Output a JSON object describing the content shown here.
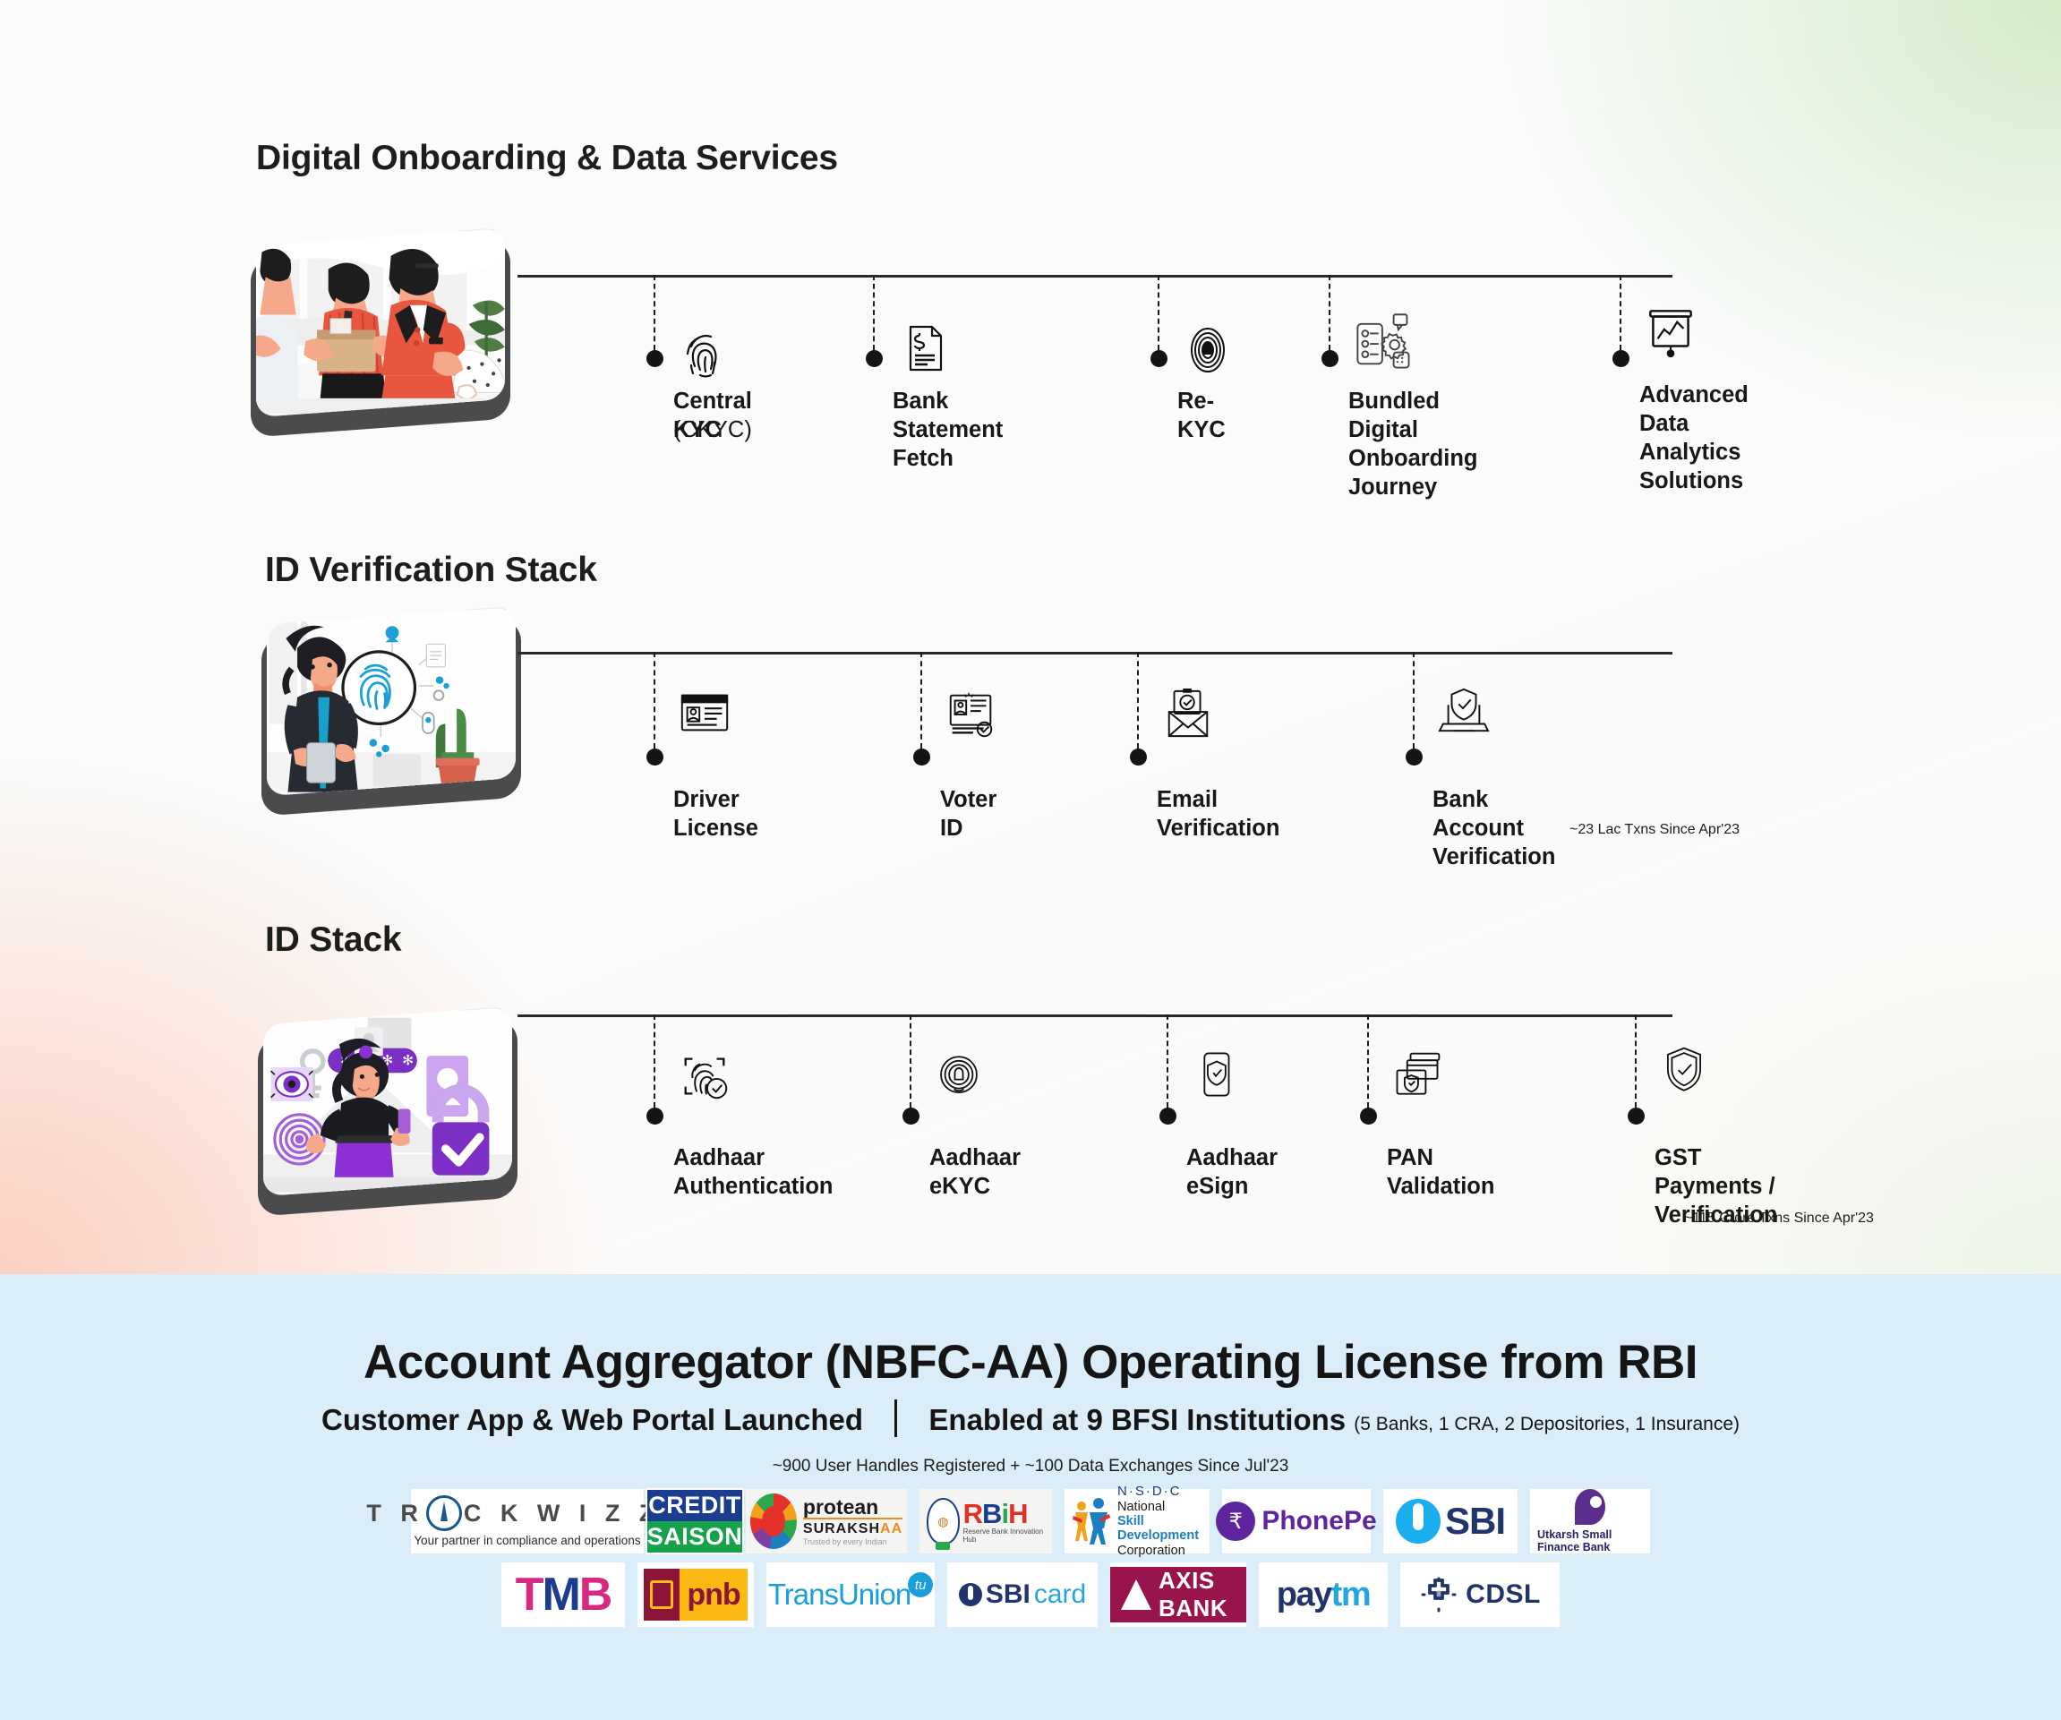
{
  "page": {
    "background_top": "#fbfcfb",
    "background_bottom": "#daedf9"
  },
  "sections": [
    {
      "title": "Digital Onboarding & Data Services",
      "illustration_name": "onboarding-team-illustration",
      "nodes": [
        {
          "label": "Central KYC",
          "sublabel": "(CKYC)",
          "icon": "fingerprint-icon",
          "note": ""
        },
        {
          "label": "Bank Statement\nFetch",
          "sublabel": "",
          "icon": "document-dollar-icon",
          "note": ""
        },
        {
          "label": "Re-KYC",
          "sublabel": "",
          "icon": "biometric-scan-icon",
          "note": ""
        },
        {
          "label": "Bundled Digital\nOnboarding Journey",
          "sublabel": "",
          "icon": "workflow-gear-icon",
          "note": ""
        },
        {
          "label": "Advanced Data\nAnalytics Solutions",
          "sublabel": "",
          "icon": "analytics-board-icon",
          "note": ""
        }
      ]
    },
    {
      "title": "ID Verification Stack",
      "illustration_name": "fingerprint-verification-illustration",
      "nodes": [
        {
          "label": "Driver\nLicense",
          "sublabel": "",
          "icon": "driver-license-icon",
          "note": ""
        },
        {
          "label": "Voter ID",
          "sublabel": "",
          "icon": "voter-id-icon",
          "note": ""
        },
        {
          "label": "Email\nVerification",
          "sublabel": "",
          "icon": "verified-email-icon",
          "note": ""
        },
        {
          "label": "Bank Account Verification",
          "sublabel": "",
          "icon": "laptop-shield-icon",
          "note": "~23 Lac Txns Since Apr'23"
        }
      ]
    },
    {
      "title": "ID Stack",
      "illustration_name": "aadhaar-security-illustration",
      "nodes": [
        {
          "label": "Aadhaar\nAuthentication",
          "sublabel": "",
          "icon": "fingerprint-check-icon",
          "note": ""
        },
        {
          "label": "Aadhaar eKYC",
          "sublabel": "",
          "icon": "biometric-circle-icon",
          "note": ""
        },
        {
          "label": "Aadhaar\neSign",
          "sublabel": "",
          "icon": "phone-shield-icon",
          "note": ""
        },
        {
          "label": "PAN Validation",
          "sublabel": "",
          "icon": "cards-shield-icon",
          "note": ""
        },
        {
          "label": "GST Payments /\nVerification",
          "sublabel": "",
          "icon": "shield-check-icon",
          "note": "~115 Crore Txns Since Apr'23"
        }
      ]
    }
  ],
  "account_aggregator": {
    "title": "Account Aggregator (NBFC-AA) Operating License from RBI",
    "sub_left": "Customer App & Web Portal Launched",
    "sub_right": "Enabled at 9 BFSI Institutions",
    "sub_right_paren": "(5 Banks, 1 CRA, 2 Depositories, 1 Insurance)",
    "note": "~900 User Handles Registered + ~100 Data Exchanges Since Jul'23",
    "logos_row1": [
      {
        "name": "trackwizz",
        "text": "TRACKWIZZ",
        "tagline": "Your partner in compliance and operations",
        "tm": "TM"
      },
      {
        "name": "credit-saison",
        "line1": "CREDIT",
        "line2": "SAISON"
      },
      {
        "name": "protean-surakshaa",
        "line1": "protean",
        "line2": "SURAKSH",
        "line2b": "AA",
        "line3": "Trusted by every Indian"
      },
      {
        "name": "rbih",
        "text": "RBiH",
        "tagline": "Reserve Bank Innovation Hub"
      },
      {
        "name": "nsdc",
        "line1": "N·S·D·C",
        "line2": "National",
        "line3": "Skill Development",
        "line4": "Corporation"
      },
      {
        "name": "phonepe",
        "text": "PhonePe"
      },
      {
        "name": "sbi",
        "text": "SBI"
      },
      {
        "name": "utkarsh-small-finance-bank",
        "text": "Utkarsh Small Finance Bank"
      }
    ],
    "logos_row2": [
      {
        "name": "tmb",
        "text": "TMB"
      },
      {
        "name": "pnb",
        "text": "pnb"
      },
      {
        "name": "transunion",
        "text": "TransUnion",
        "badge": "tu"
      },
      {
        "name": "sbi-card",
        "text1": "SBI",
        "text2": "card"
      },
      {
        "name": "axis-bank",
        "text": "AXIS BANK"
      },
      {
        "name": "paytm",
        "text1": "pay",
        "text2": "tm"
      },
      {
        "name": "cdsl",
        "text": "CDSL"
      }
    ]
  }
}
